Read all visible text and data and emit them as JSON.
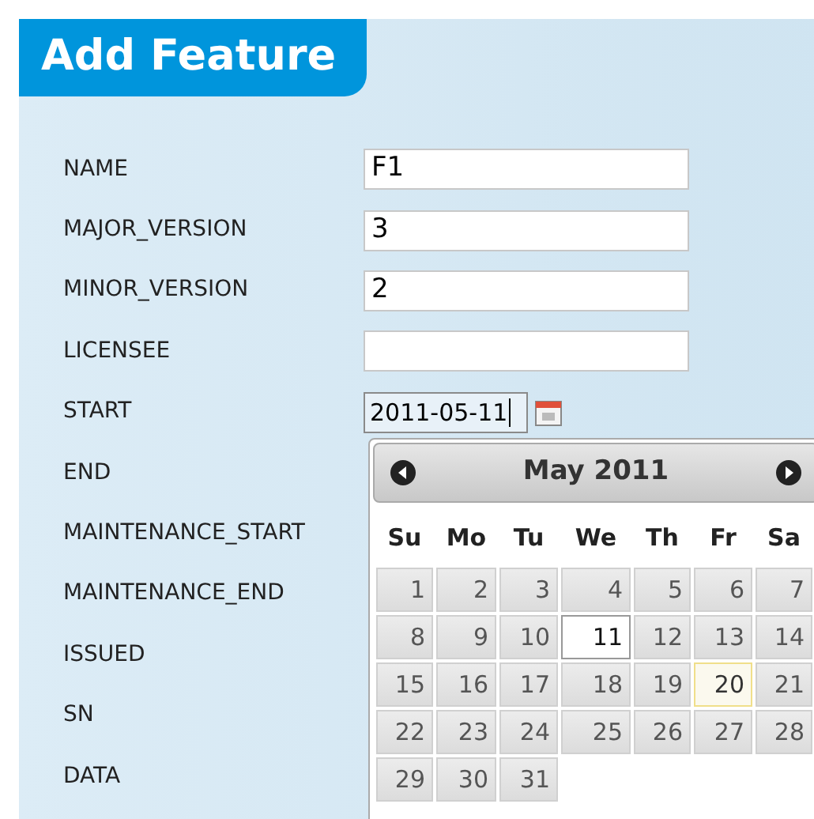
{
  "title": "Add Feature",
  "fields": [
    {
      "label": "NAME",
      "value": "F1",
      "kind": "text",
      "focused": false
    },
    {
      "label": "MAJOR_VERSION",
      "value": "3",
      "kind": "text",
      "focused": false
    },
    {
      "label": "MINOR_VERSION",
      "value": "2",
      "kind": "text",
      "focused": false
    },
    {
      "label": "LICENSEE",
      "kind": "text",
      "focused": false
    },
    {
      "label": "START",
      "value": "2011-05-11",
      "kind": "date",
      "focused": true
    },
    {
      "label": "END",
      "kind": "none"
    },
    {
      "label": "MAINTENANCE_START",
      "kind": "none"
    },
    {
      "label": "MAINTENANCE_END",
      "kind": "none"
    },
    {
      "label": "ISSUED",
      "kind": "none"
    },
    {
      "label": "SN",
      "kind": "none"
    },
    {
      "label": "DATA",
      "kind": "none"
    }
  ],
  "calendar": {
    "month": "May 2011",
    "weekdays": [
      "Su",
      "Mo",
      "Tu",
      "We",
      "Th",
      "Fr",
      "Sa"
    ],
    "days": [
      {
        "label": "1",
        "selected": false,
        "today": false
      },
      {
        "label": "2",
        "selected": false,
        "today": false
      },
      {
        "label": "3",
        "selected": false,
        "today": false
      },
      {
        "label": "4",
        "selected": false,
        "today": false
      },
      {
        "label": "5",
        "selected": false,
        "today": false
      },
      {
        "label": "6",
        "selected": false,
        "today": false
      },
      {
        "label": "7",
        "selected": false,
        "today": false
      },
      {
        "label": "8",
        "selected": false,
        "today": false
      },
      {
        "label": "9",
        "selected": false,
        "today": false
      },
      {
        "label": "10",
        "selected": false,
        "today": false
      },
      {
        "label": "11",
        "selected": true,
        "today": false
      },
      {
        "label": "12",
        "selected": false,
        "today": false
      },
      {
        "label": "13",
        "selected": false,
        "today": false
      },
      {
        "label": "14",
        "selected": false,
        "today": false
      },
      {
        "label": "15",
        "selected": false,
        "today": false
      },
      {
        "label": "16",
        "selected": false,
        "today": false
      },
      {
        "label": "17",
        "selected": false,
        "today": false
      },
      {
        "label": "18",
        "selected": false,
        "today": false
      },
      {
        "label": "19",
        "selected": false,
        "today": false
      },
      {
        "label": "20",
        "selected": false,
        "today": true
      },
      {
        "label": "21",
        "selected": false,
        "today": false
      },
      {
        "label": "22",
        "selected": false,
        "today": false
      },
      {
        "label": "23",
        "selected": false,
        "today": false
      },
      {
        "label": "24",
        "selected": false,
        "today": false
      },
      {
        "label": "25",
        "selected": false,
        "today": false
      },
      {
        "label": "26",
        "selected": false,
        "today": false
      },
      {
        "label": "27",
        "selected": false,
        "today": false
      },
      {
        "label": "28",
        "selected": false,
        "today": false
      },
      {
        "label": "29",
        "selected": false,
        "today": false
      },
      {
        "label": "30",
        "selected": false,
        "today": false
      },
      {
        "label": "31",
        "selected": false,
        "today": false
      }
    ]
  }
}
